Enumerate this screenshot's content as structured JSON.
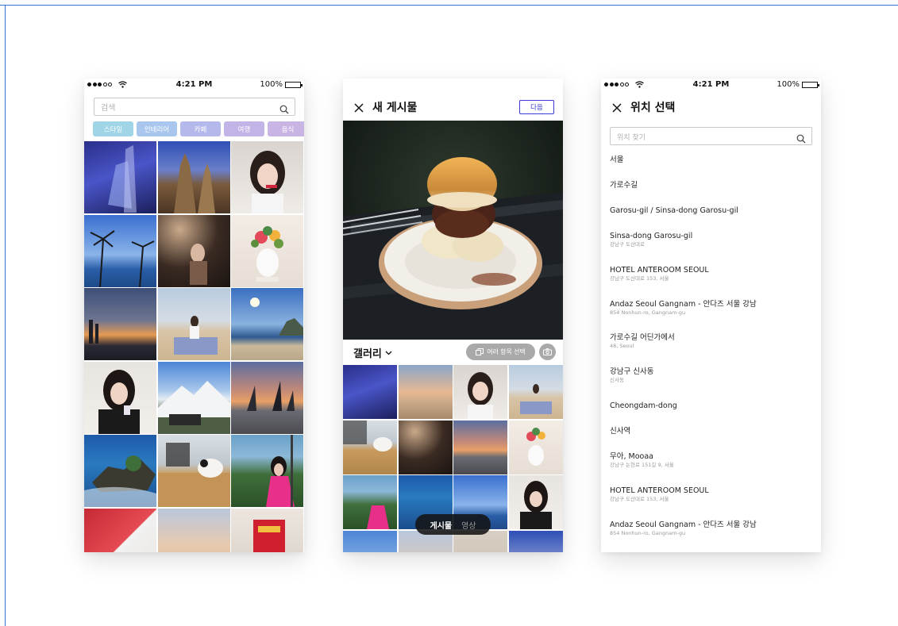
{
  "status": {
    "time": "4:21 PM",
    "battery": "100%"
  },
  "explore": {
    "search_placeholder": "검색",
    "chips": [
      {
        "label": "스타일",
        "color": "#9fd5e6"
      },
      {
        "label": "인테리어",
        "color": "#a9c6ef"
      },
      {
        "label": "카페",
        "color": "#b5b8ea"
      },
      {
        "label": "여행",
        "color": "#c2b4e6"
      },
      {
        "label": "음식",
        "color": "#c9b5e4"
      }
    ]
  },
  "new_post": {
    "title": "새 게시물",
    "next_label": "다음",
    "gallery_label": "갤러리",
    "multi_select_label": "여러 항목 선택",
    "tabs": [
      "게시물",
      "영상"
    ]
  },
  "location": {
    "title": "위치 선택",
    "search_placeholder": "위치 찾기",
    "items": [
      {
        "name": "서울",
        "sub": ""
      },
      {
        "name": "가로수길",
        "sub": ""
      },
      {
        "name": "Garosu-gil / Sinsa-dong Garosu-gil",
        "sub": ""
      },
      {
        "name": "Sinsa-dong Garosu-gil",
        "sub": "강남구 도산대로"
      },
      {
        "name": "HOTEL ANTEROOM SEOUL",
        "sub": "강남구 도산대로 153, 서울"
      },
      {
        "name": "Andaz Seoul Gangnam - 안다즈 서울 강남",
        "sub": "854 Nonhun-ro, Gangnam-gu"
      },
      {
        "name": "가로수길 어딘가에서",
        "sub": "48, Seoul"
      },
      {
        "name": "강남구 신사동",
        "sub": "신사동"
      },
      {
        "name": "Cheongdam-dong",
        "sub": ""
      },
      {
        "name": "신사역",
        "sub": ""
      },
      {
        "name": "무아, Mooaa",
        "sub": "강남구 논현로 151길 9, 서울"
      },
      {
        "name": "HOTEL ANTEROOM SEOUL",
        "sub": "강남구 도산대로 153, 서울"
      },
      {
        "name": "Andaz Seoul Gangnam - 안다즈 서울 강남",
        "sub": "854 Nonhun-ro, Gangnam-gu"
      }
    ]
  },
  "colors": {
    "accent": "#3b3bd8",
    "frame": "#3b6fd8",
    "pill": "#a9a9a9"
  }
}
